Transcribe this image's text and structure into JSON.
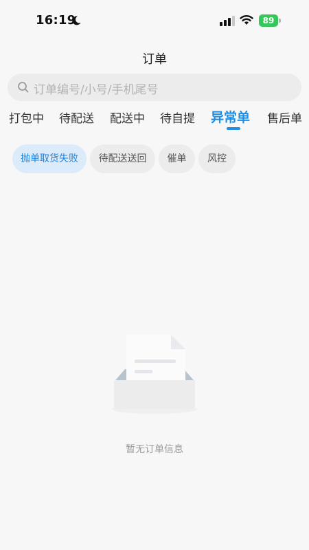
{
  "status_bar": {
    "time": "16:19",
    "battery": "89"
  },
  "nav": {
    "title": "订单"
  },
  "search": {
    "placeholder": "订单编号/小号/手机尾号"
  },
  "tabs": [
    "打包中",
    "待配送",
    "配送中",
    "待自提",
    "异常单",
    "售后单"
  ],
  "active_tab": "异常单",
  "chips": [
    "抛单取货失败",
    "待配送送回",
    "催单",
    "风控"
  ],
  "active_chip": "抛单取货失败",
  "empty_state": {
    "message": "暂无订单信息"
  },
  "colors": {
    "accent": "#1f8de3",
    "battery": "#34c759",
    "chip_active_bg": "#dcebfa"
  }
}
